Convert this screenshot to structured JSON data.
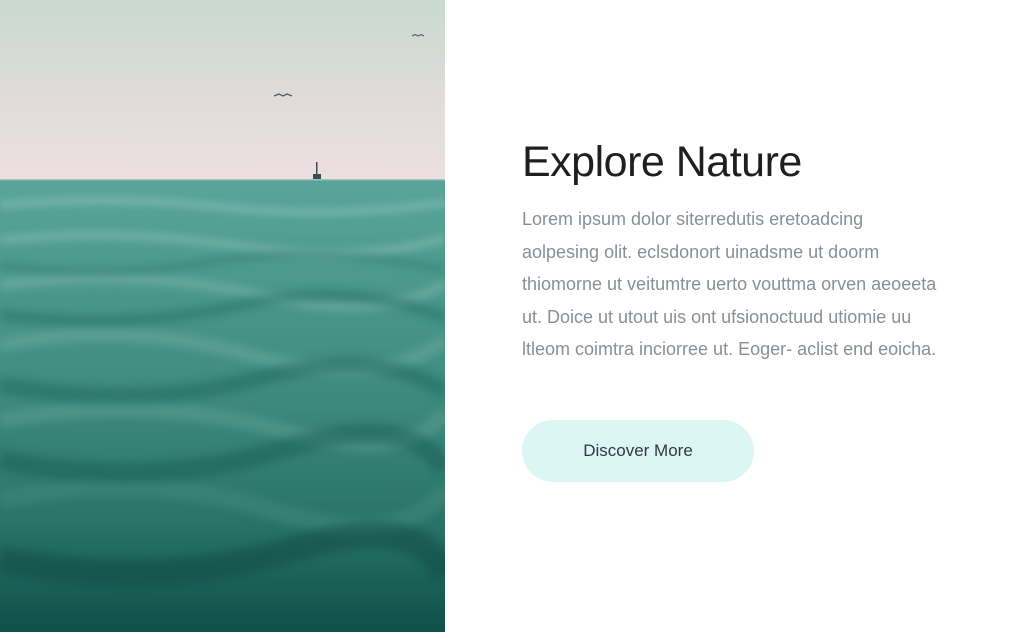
{
  "hero": {
    "title": "Explore Nature",
    "body": "Lorem ipsum dolor siterredutis eretoadcing aolpesing olit. eclsdonort uinadsme ut doorm thiomorne ut veitumtre uerto vouttma orven aeoeeta ut. Doice ut utout uis ont ufsionoctuud utiomie uu ltleom coimtra inciorree ut. Eoger- aclist end eoicha.",
    "cta_label": "Discover More"
  },
  "colors": {
    "sea": "#2f7a70",
    "sky": "#e8dfe0",
    "cta_background": "#dcf6f6"
  },
  "icons": [
    "seagull-icon",
    "sailboat-icon"
  ]
}
